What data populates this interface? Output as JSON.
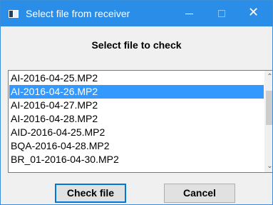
{
  "window": {
    "title": "Select file from receiver",
    "controls": {
      "minimize": "minimize",
      "maximize": "maximize",
      "close": "✕"
    }
  },
  "dialog": {
    "heading": "Select file to check"
  },
  "file_list": {
    "items": [
      "AI-2016-04-25.MP2",
      "AI-2016-04-26.MP2",
      "AI-2016-04-27.MP2",
      "AI-2016-04-28.MP2",
      "AID-2016-04-25.MP2",
      "BQA-2016-04-28.MP2",
      "BR_01-2016-04-30.MP2"
    ],
    "selected_index": 1
  },
  "buttons": {
    "check_label": "Check file",
    "cancel_label": "Cancel"
  },
  "colors": {
    "titlebar": "#2a8ee8",
    "selection": "#3399ff",
    "focus_border": "#0078d7"
  },
  "icons": {
    "app": "window-app-icon",
    "scroll_up": "chevron-up-icon",
    "scroll_down": "chevron-down-icon"
  }
}
